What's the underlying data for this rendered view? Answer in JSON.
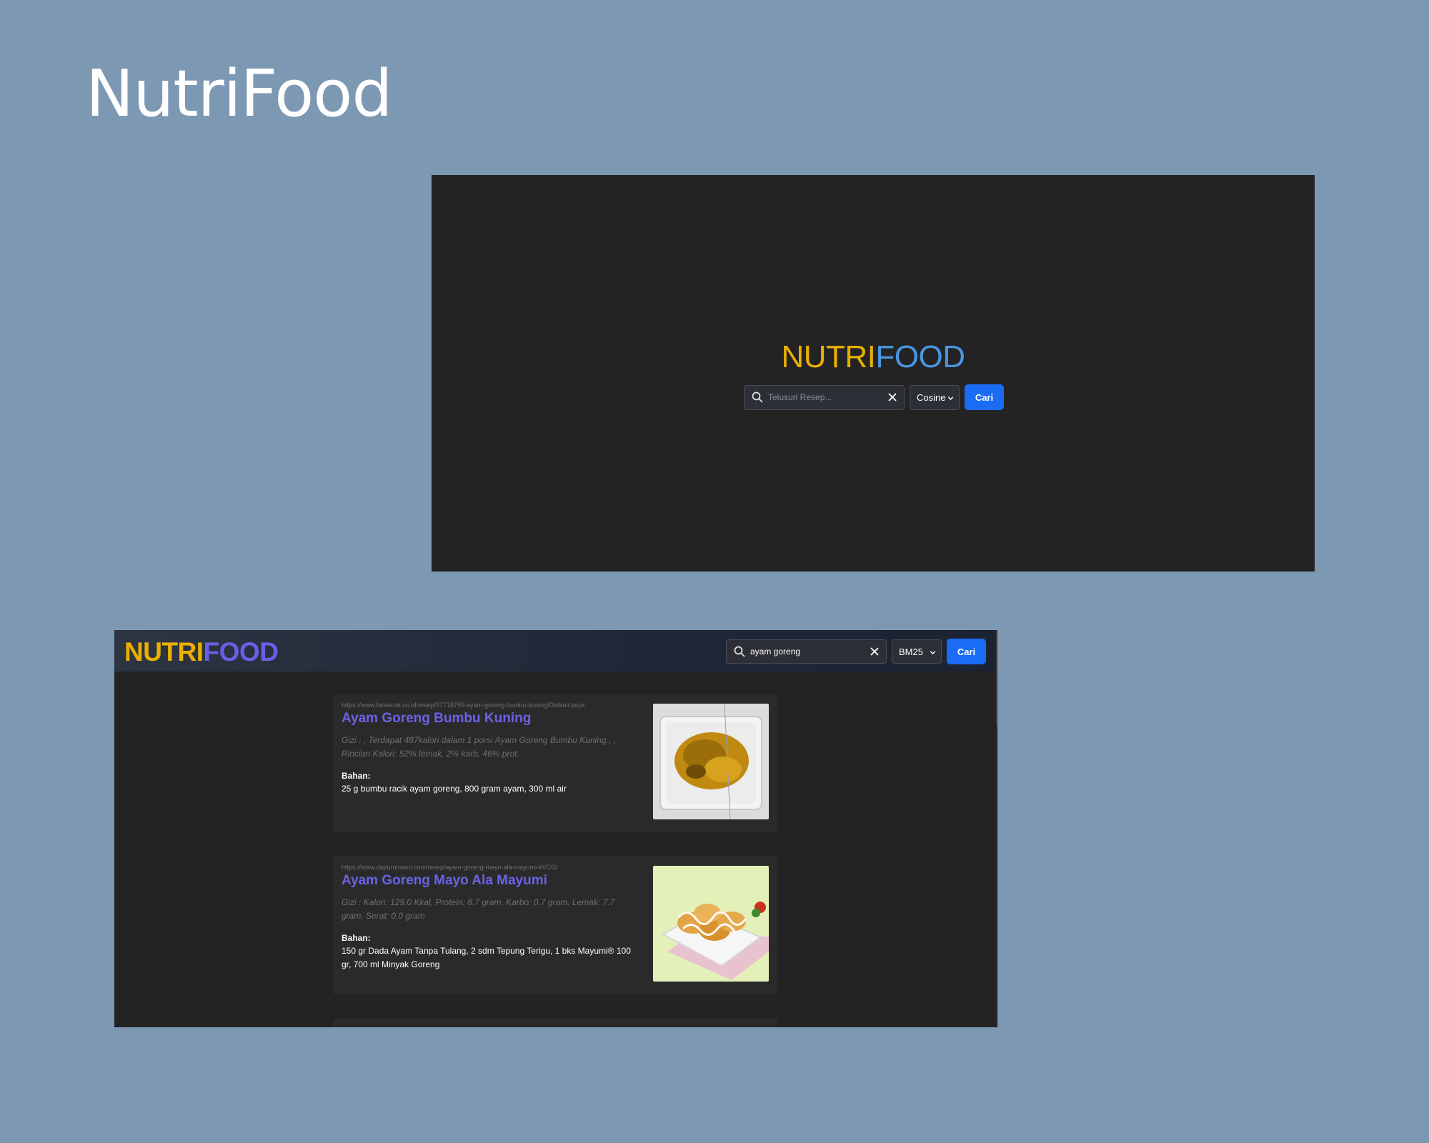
{
  "slide": {
    "title": "NutriFood"
  },
  "home": {
    "logo": {
      "part1": "NUTRI",
      "part2": "FOOD",
      "color1": "#eab000",
      "color2": "#4a95e0"
    },
    "search": {
      "placeholder": "Telusuri Resep...",
      "value": "",
      "icon": "search-icon",
      "clear_icon": "close-icon"
    },
    "method": {
      "selected": "Cosine"
    },
    "submit_label": "Cari"
  },
  "results": {
    "logo": {
      "part1": "NUTRI",
      "part2": "FOOD",
      "color1": "#eab000",
      "color2": "#6b5ee6"
    },
    "search": {
      "value": "ayam goreng",
      "icon": "search-icon",
      "clear_icon": "close-icon"
    },
    "method": {
      "selected": "BM25"
    },
    "submit_label": "Cari",
    "items": [
      {
        "url": "https://www.fatsecret.co.id/resep/57718759-ayam-goreng-bumbu-kuning/Default.aspx",
        "title": "Ayam Goreng Bumbu Kuning",
        "nutrition": "Gizi : , Terdapat 487kalori dalam 1 porsi Ayam Goreng Bumbu Kuning., , Rincian Kalori: 52% lemak, 2% karb, 46% prot.",
        "ingredients_label": "Bahan:",
        "ingredients": "25 g bumbu racik ayam goreng, 800 gram ayam, 300 ml air"
      },
      {
        "url": "https://www.dapurumami.com/resep/ayam-goreng-mayo-ala-mayumi-kVCGI",
        "title": "Ayam Goreng Mayo Ala Mayumi",
        "nutrition": "Gizi : Kalori: 129.0 Kkal, Protein: 8.7 gram, Karbo: 0.7 gram, Lemak: 7.7 gram, Serat: 0.0 gram",
        "ingredients_label": "Bahan:",
        "ingredients": "150 gr Dada Ayam Tanpa Tulang, 2 sdm Tepung Terigu, 1 bks Mayumi® 100 gr, 700 ml Minyak Goreng"
      }
    ]
  },
  "colors": {
    "background": "#7d98b3",
    "app_bg": "#232323",
    "card_bg": "#2a2a2a",
    "accent": "#1a6cf5",
    "title_link": "#6b63e6"
  }
}
